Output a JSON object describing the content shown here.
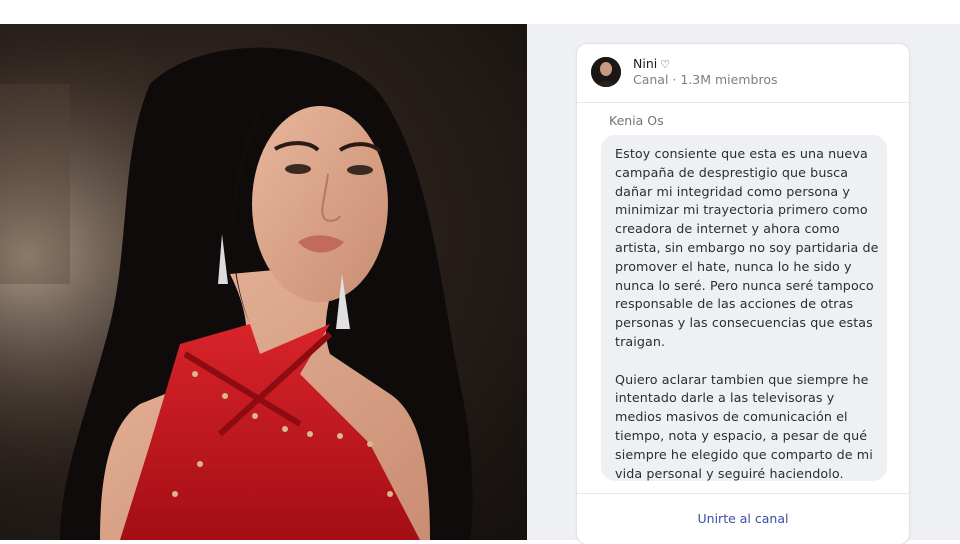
{
  "channel": {
    "name": "Nini",
    "heart_icon": "heart-outline-icon",
    "meta": "Canal · 1.3M miembros"
  },
  "post": {
    "author": "Kenia Os",
    "message": "Estoy consiente que esta es una nueva campaña de desprestigio que busca dañar mi integridad como persona y minimizar mi trayectoria primero como creadora de internet y ahora como artista, sin embargo no soy partidaria de promover el hate, nunca lo he sido y nunca lo seré. Pero nunca seré tampoco responsable de las acciones de otras personas y las consecuencias que estas traigan.\n\nQuiero aclarar tambien que siempre he intentado darle a las televisoras y medios masivos de comunicación el tiempo, nota  y espacio, a pesar de qué siempre he elegido que comparto de mi vida personal y seguiré haciendolo."
  },
  "footer": {
    "join_label": "Unirte al canal"
  },
  "colors": {
    "panel_bg": "#eef0f3",
    "bubble_bg": "#eef0f3",
    "link": "#3a4fa8",
    "dress": "#c8141c"
  }
}
